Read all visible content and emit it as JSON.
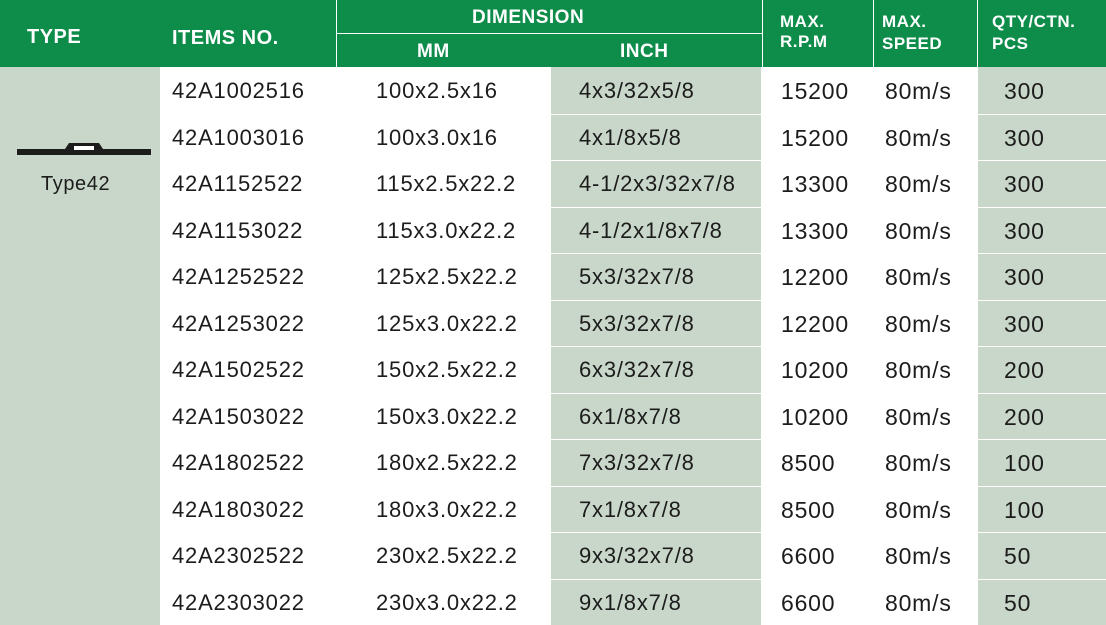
{
  "header": {
    "type": "TYPE",
    "items_no": "ITEMS NO.",
    "dimension": "DIMENSION",
    "mm": "MM",
    "inch": "INCH",
    "max_rpm_l1": "MAX.",
    "max_rpm_l2": "R.P.M",
    "max_speed_l1": "MAX.",
    "max_speed_l2": "SPEED",
    "qty_l1": "QTY/CTN.",
    "qty_l2": "PCS"
  },
  "type_name": "Type42",
  "icon": "depressed-center-wheel-icon",
  "colors": {
    "header_green": "#0d8c4a",
    "light_green": "#c8d7c9",
    "text": "#1c1c1c"
  },
  "rows": [
    {
      "item": "42A1002516",
      "mm": "100x2.5x16",
      "inch": "4x3/32x5/8",
      "rpm": "15200",
      "speed": "80m/s",
      "qty": "300"
    },
    {
      "item": "42A1003016",
      "mm": "100x3.0x16",
      "inch": "4x1/8x5/8",
      "rpm": "15200",
      "speed": "80m/s",
      "qty": "300"
    },
    {
      "item": "42A1152522",
      "mm": "115x2.5x22.2",
      "inch": "4-1/2x3/32x7/8",
      "rpm": "13300",
      "speed": "80m/s",
      "qty": "300"
    },
    {
      "item": "42A1153022",
      "mm": "115x3.0x22.2",
      "inch": "4-1/2x1/8x7/8",
      "rpm": "13300",
      "speed": "80m/s",
      "qty": "300"
    },
    {
      "item": "42A1252522",
      "mm": "125x2.5x22.2",
      "inch": "5x3/32x7/8",
      "rpm": "12200",
      "speed": "80m/s",
      "qty": "300"
    },
    {
      "item": "42A1253022",
      "mm": "125x3.0x22.2",
      "inch": "5x3/32x7/8",
      "rpm": "12200",
      "speed": "80m/s",
      "qty": "300"
    },
    {
      "item": "42A1502522",
      "mm": "150x2.5x22.2",
      "inch": "6x3/32x7/8",
      "rpm": "10200",
      "speed": "80m/s",
      "qty": "200"
    },
    {
      "item": "42A1503022",
      "mm": "150x3.0x22.2",
      "inch": "6x1/8x7/8",
      "rpm": "10200",
      "speed": "80m/s",
      "qty": "200"
    },
    {
      "item": "42A1802522",
      "mm": "180x2.5x22.2",
      "inch": "7x3/32x7/8",
      "rpm": "8500",
      "speed": "80m/s",
      "qty": "100"
    },
    {
      "item": "42A1803022",
      "mm": "180x3.0x22.2",
      "inch": "7x1/8x7/8",
      "rpm": "8500",
      "speed": "80m/s",
      "qty": "100"
    },
    {
      "item": "42A2302522",
      "mm": "230x2.5x22.2",
      "inch": "9x3/32x7/8",
      "rpm": "6600",
      "speed": "80m/s",
      "qty": "50"
    },
    {
      "item": "42A2303022",
      "mm": "230x3.0x22.2",
      "inch": "9x1/8x7/8",
      "rpm": "6600",
      "speed": "80m/s",
      "qty": "50"
    }
  ]
}
